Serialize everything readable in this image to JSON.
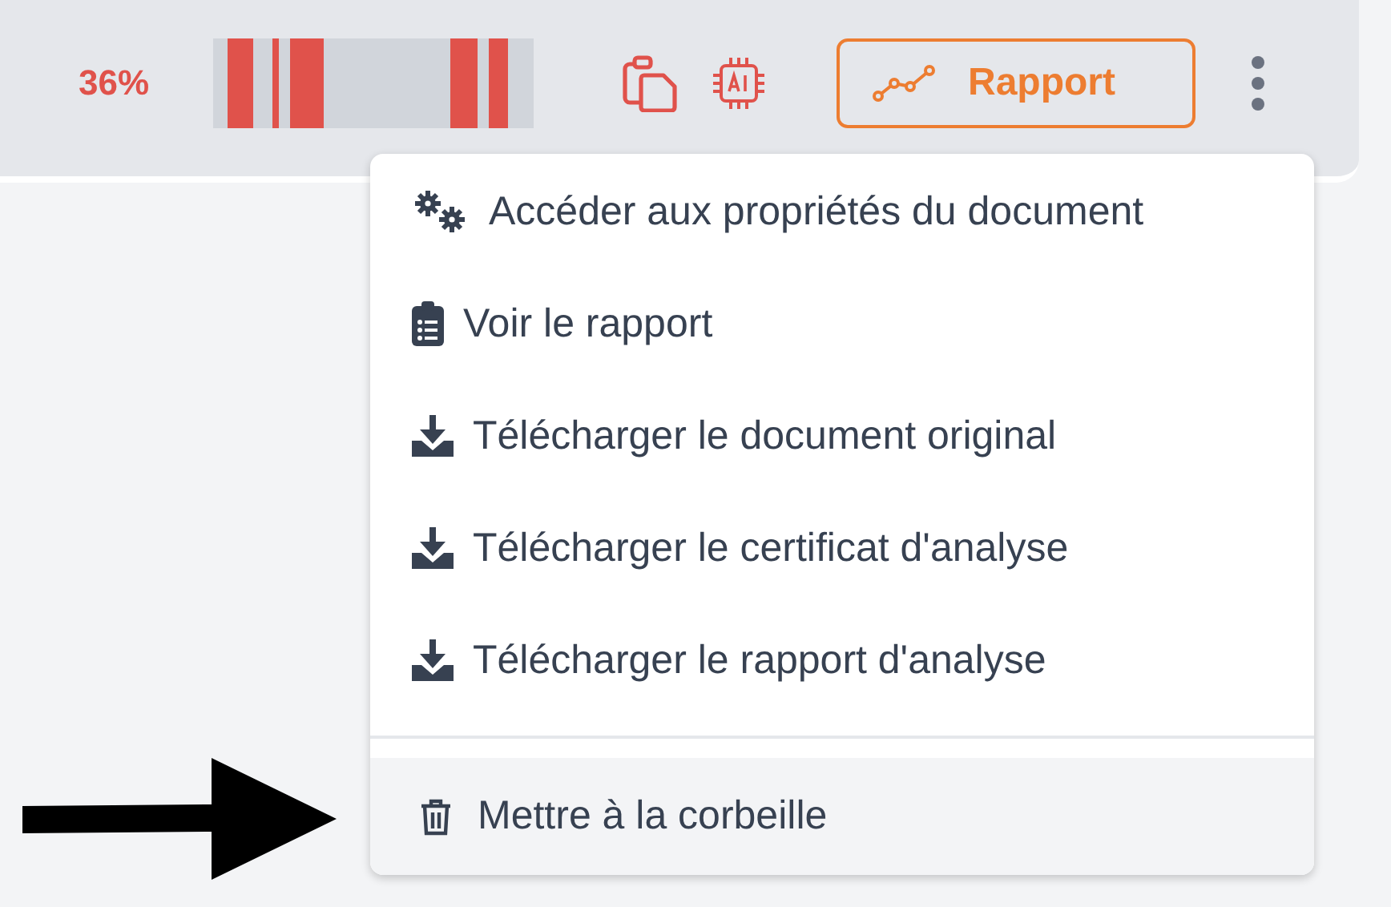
{
  "toolbar": {
    "score": "36%",
    "report_button": "Rapport"
  },
  "menu": {
    "items": [
      {
        "label": "Accéder aux propriétés du document",
        "hovered": false
      },
      {
        "label": "Voir le rapport",
        "hovered": false
      },
      {
        "label": "Télécharger le document original",
        "hovered": false
      },
      {
        "label": "Télécharger le certificat d'analyse",
        "hovered": false
      },
      {
        "label": "Télécharger le rapport d'analyse",
        "hovered": false
      }
    ],
    "footer_items": [
      {
        "label": "Mettre à la corbeille",
        "hovered": true
      }
    ]
  }
}
